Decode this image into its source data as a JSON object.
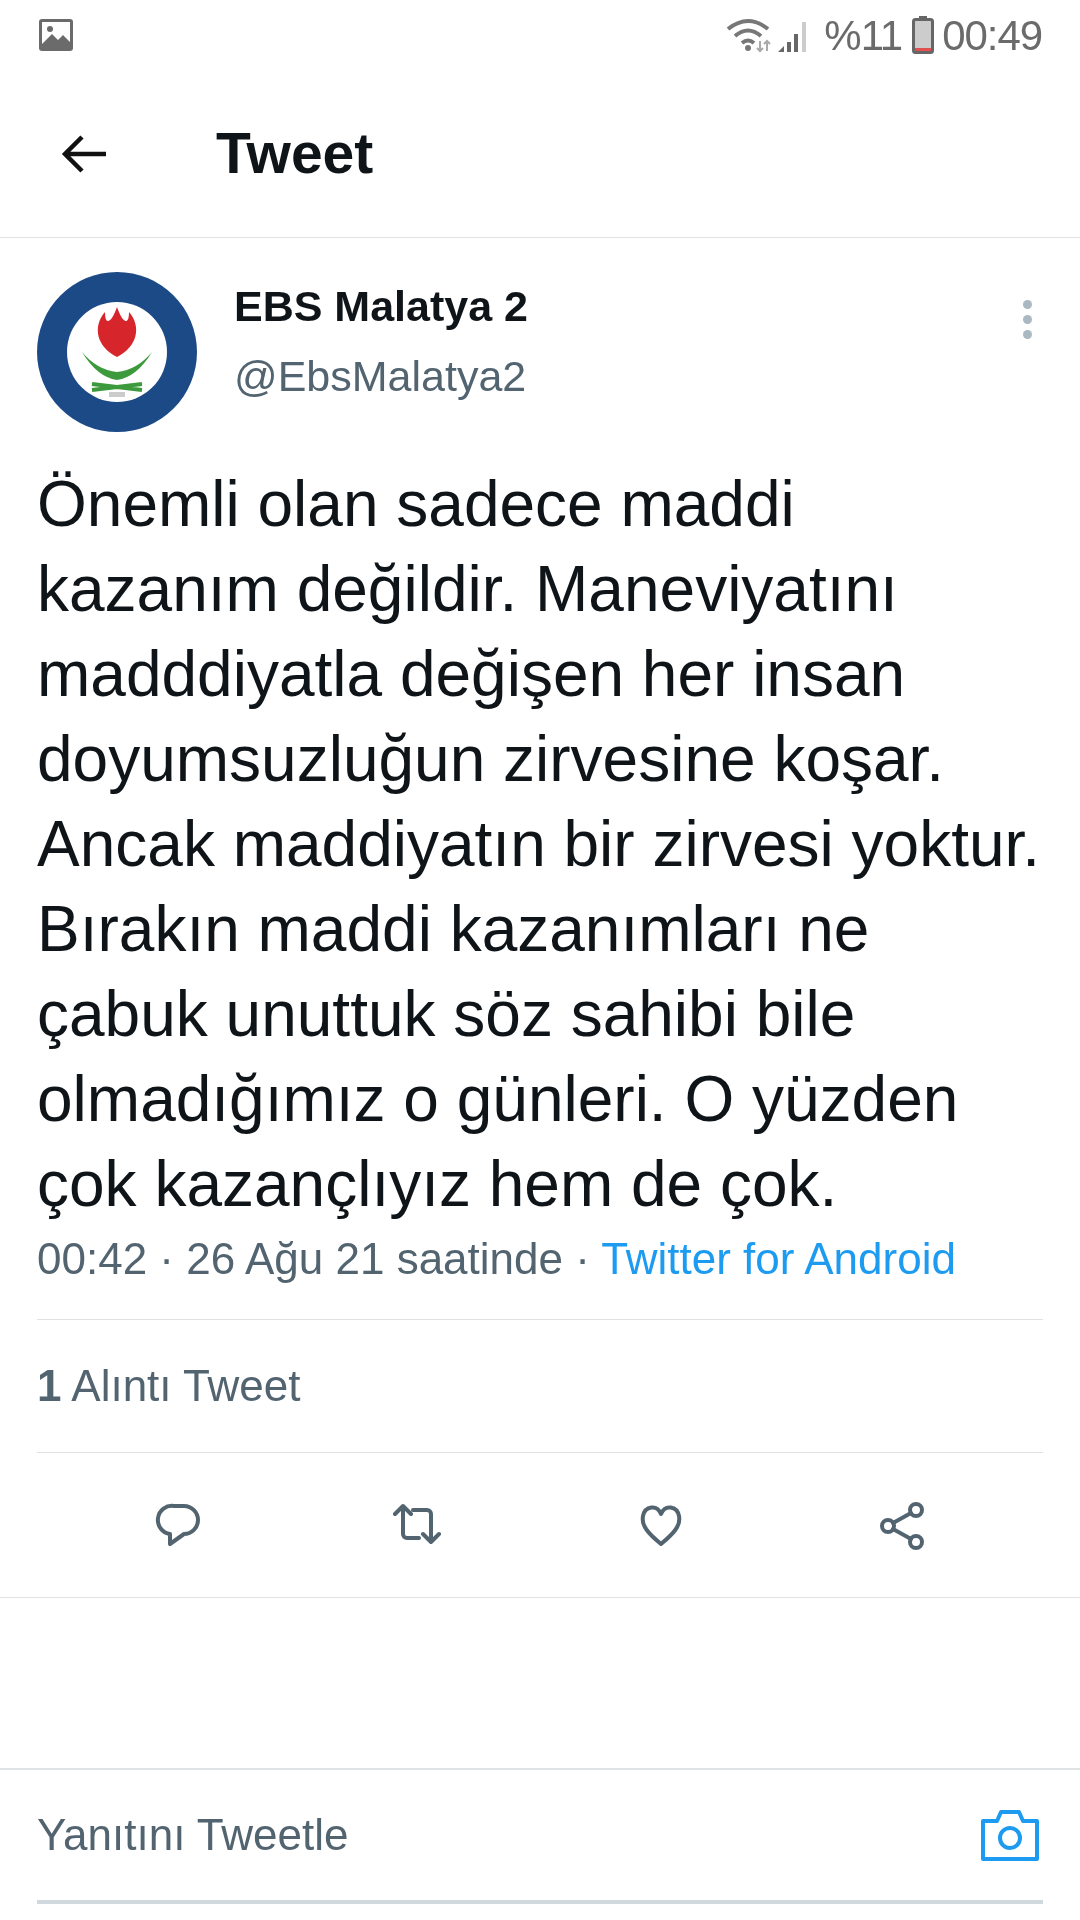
{
  "status_bar": {
    "battery": "%11",
    "time": "00:49"
  },
  "header": {
    "title": "Tweet"
  },
  "tweet": {
    "name": "EBS Malatya 2",
    "handle": "@EbsMalatya2",
    "text": "Önemli olan sadece maddi kazanım değildir. Maneviyatını madddiyatla değişen her insan doyumsuzluğun zirvesine koşar. Ancak maddiyatın bir zirvesi yoktur. Bırakın maddi kazanımları ne çabuk unuttuk söz sahibi bile olmadığımız o günleri. O yüzden çok kazançlıyız hem de çok.",
    "meta": "00:42 · 26 Ağu 21 saatinde · ",
    "source": "Twitter for Android",
    "quotes": "**1** Alıntı Tweet"
  },
  "actions": [
    {
      "kind": "reply"
    },
    {
      "kind": "retweet"
    },
    {
      "kind": "like"
    },
    {
      "kind": "share"
    }
  ],
  "reply_box": {
    "placeholder": "Yanıtını Tweetle"
  }
}
